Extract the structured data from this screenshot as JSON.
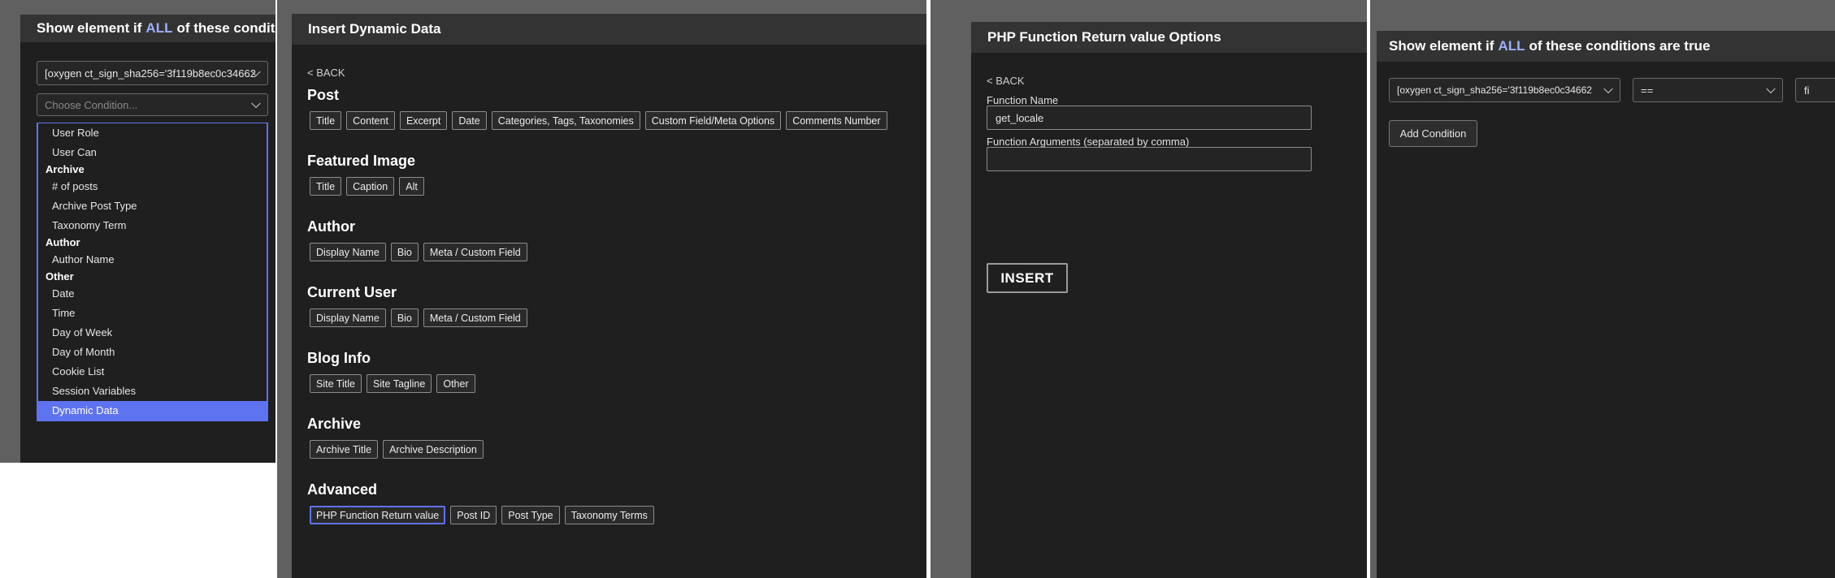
{
  "panel1": {
    "title_prefix": "Show element if",
    "title_highlight": "ALL",
    "title_suffix": "of these conditions",
    "shortcode_select": "[oxygen ct_sign_sha256='3f119b8ec0c34662",
    "condition_placeholder": "Choose Condition...",
    "dropdown": {
      "top_items": [
        "User Role",
        "User Can"
      ],
      "archive_label": "Archive",
      "archive_items": [
        "# of posts",
        "Archive Post Type",
        "Taxonomy Term"
      ],
      "author_label": "Author",
      "author_items": [
        "Author Name"
      ],
      "other_label": "Other",
      "other_items": [
        "Date",
        "Time",
        "Day of Week",
        "Day of Month",
        "Cookie List",
        "Session Variables",
        "Dynamic Data"
      ]
    }
  },
  "panel2": {
    "title": "Insert Dynamic Data",
    "back": "< BACK",
    "sections": [
      {
        "title": "Post",
        "items": [
          "Title",
          "Content",
          "Excerpt",
          "Date",
          "Categories, Tags, Taxonomies",
          "Custom Field/Meta Options",
          "Comments Number"
        ]
      },
      {
        "title": "Featured Image",
        "items": [
          "Title",
          "Caption",
          "Alt"
        ]
      },
      {
        "title": "Author",
        "items": [
          "Display Name",
          "Bio",
          "Meta / Custom Field"
        ]
      },
      {
        "title": "Current User",
        "items": [
          "Display Name",
          "Bio",
          "Meta / Custom Field"
        ]
      },
      {
        "title": "Blog Info",
        "items": [
          "Site Title",
          "Site Tagline",
          "Other"
        ]
      },
      {
        "title": "Archive",
        "items": [
          "Archive Title",
          "Archive Description"
        ]
      },
      {
        "title": "Advanced",
        "items": [
          "PHP Function Return value",
          "Post ID",
          "Post Type",
          "Taxonomy Terms"
        ]
      }
    ],
    "selected_item": "PHP Function Return value"
  },
  "panel3": {
    "title": "PHP Function Return value Options",
    "back": "< BACK",
    "function_name_label": "Function Name",
    "function_name_value": "get_locale",
    "function_args_label": "Function Arguments (separated by comma)",
    "function_args_value": "",
    "insert_label": "INSERT"
  },
  "panel4": {
    "title_prefix": "Show element if",
    "title_highlight": "ALL",
    "title_suffix": "of these conditions are true",
    "shortcode_select": "[oxygen ct_sign_sha256='3f119b8ec0c34662",
    "operator_select": "==",
    "value_input": "fi",
    "add_condition_label": "Add Condition"
  },
  "colors": {
    "accent": "#5e73f0",
    "title_highlight": "#9db0ff",
    "dialog_background": "#1f1f1f",
    "header_background": "#333333",
    "backdrop": "#606060"
  }
}
